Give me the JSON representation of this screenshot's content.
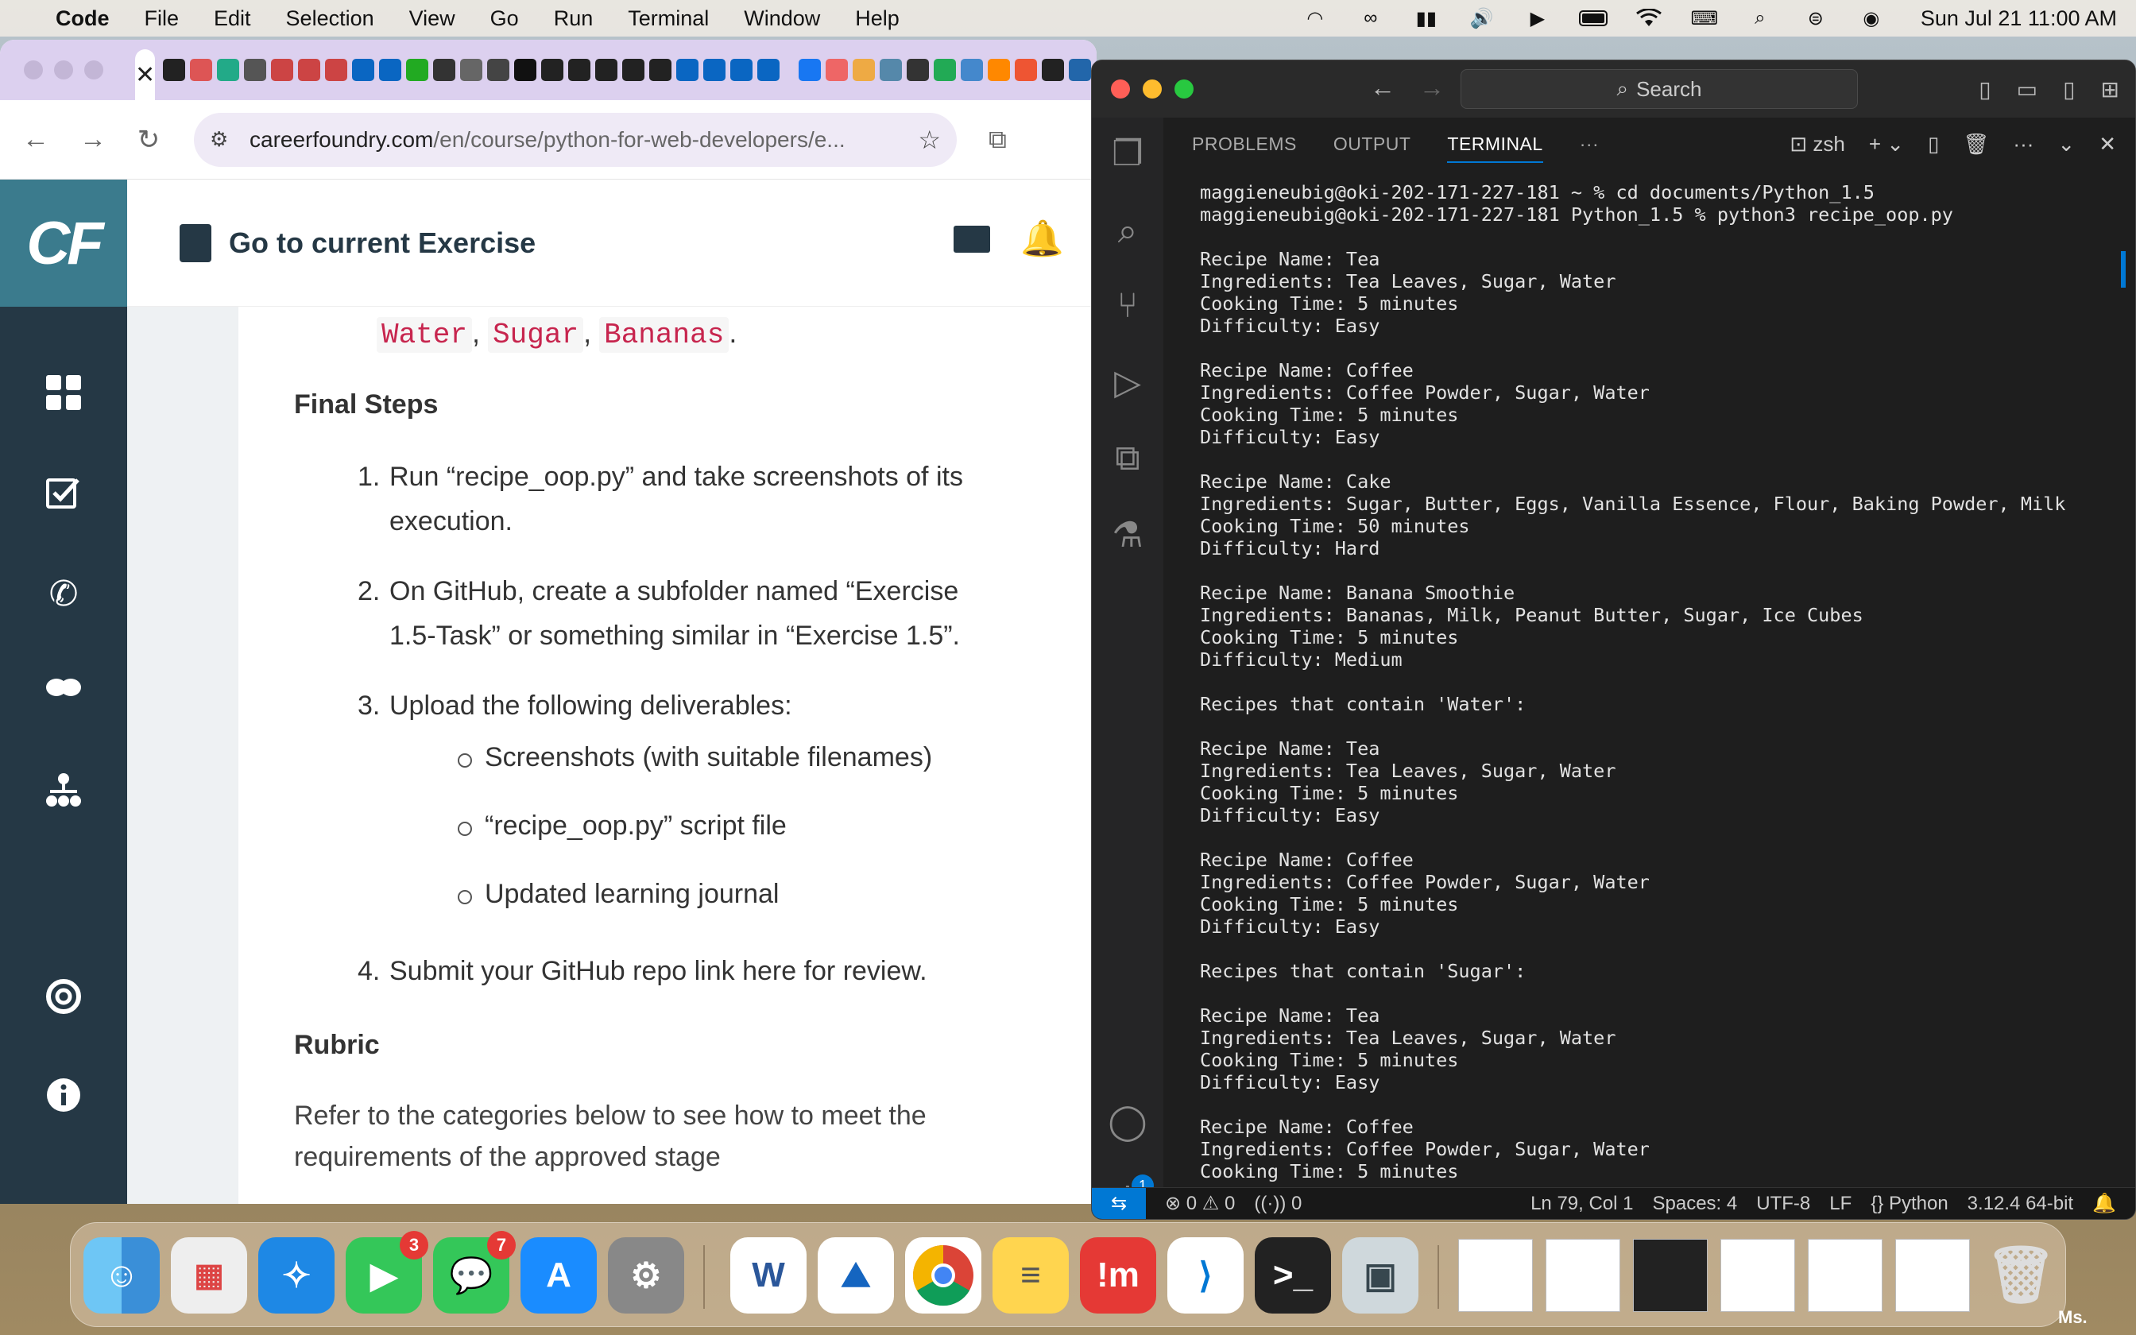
{
  "menubar": {
    "app": "Code",
    "menus": [
      "File",
      "Edit",
      "Selection",
      "View",
      "Go",
      "Run",
      "Terminal",
      "Window",
      "Help"
    ],
    "clock": "Sun Jul 21  11:00 AM"
  },
  "browser": {
    "tab_close": "✕",
    "url_host": "careerfoundry.com",
    "url_path": "/en/course/python-for-web-developers/e..."
  },
  "cf": {
    "logo": "CF",
    "goto_label": "Go to current Exercise",
    "chips": [
      "Water",
      "Sugar",
      "Bananas"
    ],
    "final_steps": "Final Steps",
    "steps": [
      {
        "num": "1.",
        "line1": "Run “recipe_oop.py” and take screenshots of its",
        "line2": "execution."
      },
      {
        "num": "2.",
        "line1": "On GitHub, create a subfolder named “Exercise",
        "line2": "1.5-Task” or something similar in “Exercise 1.5”."
      },
      {
        "num": "3.",
        "line1": "Upload the following deliverables:",
        "line2": ""
      },
      {
        "num": "4.",
        "line1": "Submit your GitHub repo link here for review.",
        "line2": ""
      }
    ],
    "deliverables": [
      "Screenshots (with suitable filenames)",
      "“recipe_oop.py” script file",
      "Updated learning journal"
    ],
    "rubric_title": "Rubric",
    "rubric_text": "Refer to the categories below to see how to meet the requirements of the approved stage"
  },
  "vscode": {
    "search": "Search",
    "tabs": [
      "PROBLEMS",
      "OUTPUT",
      "TERMINAL"
    ],
    "active_tab": "TERMINAL",
    "more": "···",
    "shell": "zsh",
    "terminal_lines": [
      "maggieneubig@oki-202-171-227-181 ~ % cd documents/Python_1.5",
      "maggieneubig@oki-202-171-227-181 Python_1.5 % python3 recipe_oop.py",
      "",
      "Recipe Name: Tea",
      "Ingredients: Tea Leaves, Sugar, Water",
      "Cooking Time: 5 minutes",
      "Difficulty: Easy",
      "",
      "Recipe Name: Coffee",
      "Ingredients: Coffee Powder, Sugar, Water",
      "Cooking Time: 5 minutes",
      "Difficulty: Easy",
      "",
      "Recipe Name: Cake",
      "Ingredients: Sugar, Butter, Eggs, Vanilla Essence, Flour, Baking Powder, Milk",
      "Cooking Time: 50 minutes",
      "Difficulty: Hard",
      "",
      "Recipe Name: Banana Smoothie",
      "Ingredients: Bananas, Milk, Peanut Butter, Sugar, Ice Cubes",
      "Cooking Time: 5 minutes",
      "Difficulty: Medium",
      "",
      "Recipes that contain 'Water':",
      "",
      "Recipe Name: Tea",
      "Ingredients: Tea Leaves, Sugar, Water",
      "Cooking Time: 5 minutes",
      "Difficulty: Easy",
      "",
      "Recipe Name: Coffee",
      "Ingredients: Coffee Powder, Sugar, Water",
      "Cooking Time: 5 minutes",
      "Difficulty: Easy",
      "",
      "Recipes that contain 'Sugar':",
      "",
      "Recipe Name: Tea",
      "Ingredients: Tea Leaves, Sugar, Water",
      "Cooking Time: 5 minutes",
      "Difficulty: Easy",
      "",
      "Recipe Name: Coffee",
      "Ingredients: Coffee Powder, Sugar, Water",
      "Cooking Time: 5 minutes"
    ],
    "status": {
      "errors": "0",
      "warnings": "0",
      "ports": "0",
      "position": "Ln 79, Col 1",
      "spaces": "Spaces: 4",
      "encoding": "UTF-8",
      "eol": "LF",
      "language": "Python",
      "interpreter": "3.12.4 64-bit"
    },
    "settings_badge": "1"
  },
  "dock": {
    "facetime_badge": "3",
    "messages_badge": "7",
    "ms_label": "Ms."
  }
}
